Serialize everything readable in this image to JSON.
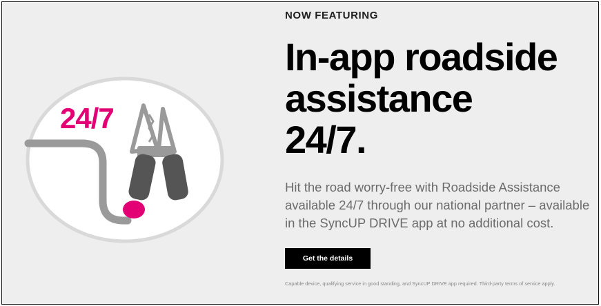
{
  "hero": {
    "eyebrow": "NOW FEATURING",
    "headline_line1": "In-app roadside",
    "headline_line2": "assistance",
    "headline_line3": "24/7.",
    "body": "Hit the road worry-free with Roadside Assistance available 24/7 through our national partner – available in the SyncUP DRIVE app at no additional cost.",
    "cta_label": "Get the details",
    "disclaimer": "Capable device, qualifying service in good standing, and SyncUP DRIVE app required. Third-party terms of service apply."
  },
  "illustration": {
    "badge_text": "24/7",
    "icon": "jumper-cable-clamp-icon",
    "colors": {
      "magenta": "#e20074",
      "grip": "#555555",
      "metal": "#9a9a9a",
      "badge_bg": "#ffffff",
      "badge_ring": "#dddddd"
    }
  },
  "colors": {
    "background": "#eeeeee",
    "text_primary": "#000000",
    "text_body": "#6b6b6b",
    "button_bg": "#000000",
    "button_text": "#ffffff"
  }
}
